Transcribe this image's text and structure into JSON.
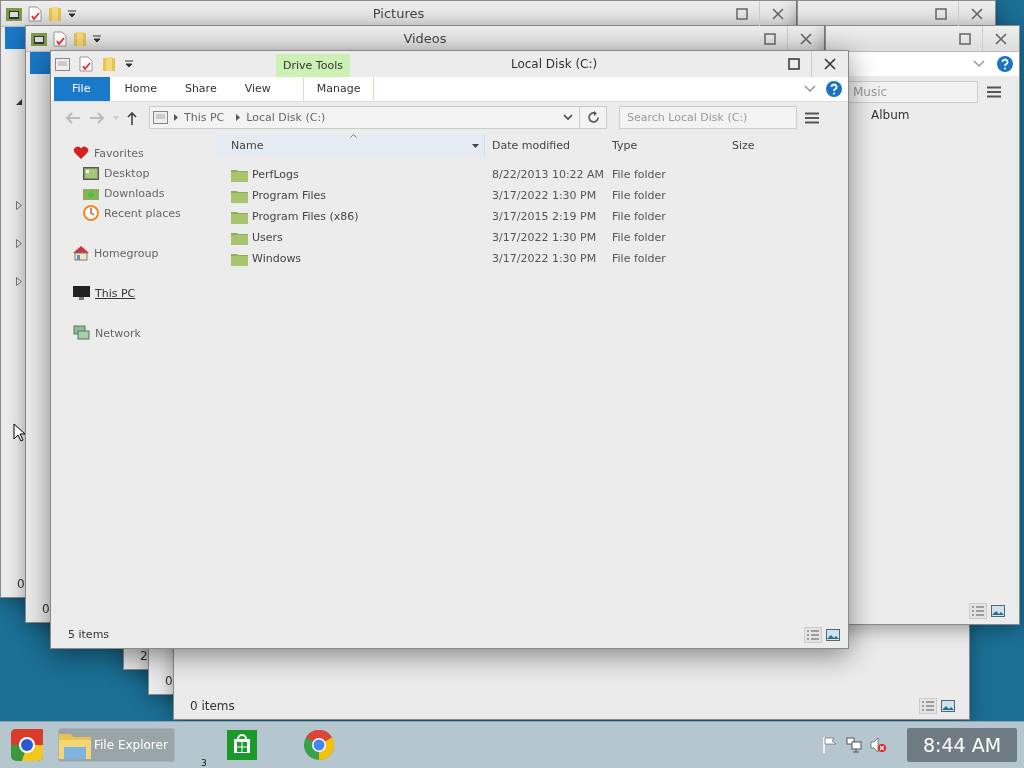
{
  "background_windows": [
    {
      "kind": "explorer",
      "title": "Pictures",
      "status": "0"
    },
    {
      "kind": "blank"
    },
    {
      "kind": "stub",
      "status": "2"
    },
    {
      "kind": "stub",
      "status": "0"
    },
    {
      "kind": "stub",
      "status": "0 items"
    },
    {
      "kind": "explorer",
      "title": "Videos",
      "status": "0"
    },
    {
      "kind": "music",
      "search_placeholder": "Music",
      "columns": [
        "Album"
      ]
    }
  ],
  "window": {
    "title": "Local Disk (C:)",
    "context_tab": "Drive Tools",
    "ribbon_tabs": [
      {
        "label": "File",
        "kind": "file"
      },
      {
        "label": "Home",
        "kind": "plain"
      },
      {
        "label": "Share",
        "kind": "plain"
      },
      {
        "label": "View",
        "kind": "plain"
      },
      {
        "label": "Manage",
        "kind": "context"
      }
    ],
    "breadcrumb": [
      "This PC",
      "Local Disk (C:)"
    ],
    "search": {
      "placeholder": "Search Local Disk (C:)"
    },
    "nav": [
      {
        "label": "Favorites",
        "hovered": false,
        "children": [
          {
            "label": "Desktop"
          },
          {
            "label": "Downloads"
          },
          {
            "label": "Recent places"
          }
        ]
      },
      {
        "label": "Homegroup",
        "hovered": false
      },
      {
        "label": "This PC",
        "hovered": true
      },
      {
        "label": "Network",
        "hovered": false
      }
    ],
    "columns": [
      {
        "label": "Name",
        "sorted": true
      },
      {
        "label": "Date modified",
        "sorted": false
      },
      {
        "label": "Type",
        "sorted": false
      },
      {
        "label": "Size",
        "sorted": false
      }
    ],
    "files": [
      {
        "name": "PerfLogs",
        "date_modified": "8/22/2013 10:22 AM",
        "type": "File folder"
      },
      {
        "name": "Program Files",
        "date_modified": "3/17/2022 1:30 PM",
        "type": "File folder"
      },
      {
        "name": "Program Files (x86)",
        "date_modified": "3/17/2015 2:19 PM",
        "type": "File folder"
      },
      {
        "name": "Users",
        "date_modified": "3/17/2022 1:30 PM",
        "type": "File folder"
      },
      {
        "name": "Windows",
        "date_modified": "3/17/2022 1:30 PM",
        "type": "File folder"
      }
    ],
    "status": "5 items"
  },
  "taskbar": {
    "button_label": "File Explorer",
    "badge": "3",
    "clock": "8:44 AM"
  }
}
